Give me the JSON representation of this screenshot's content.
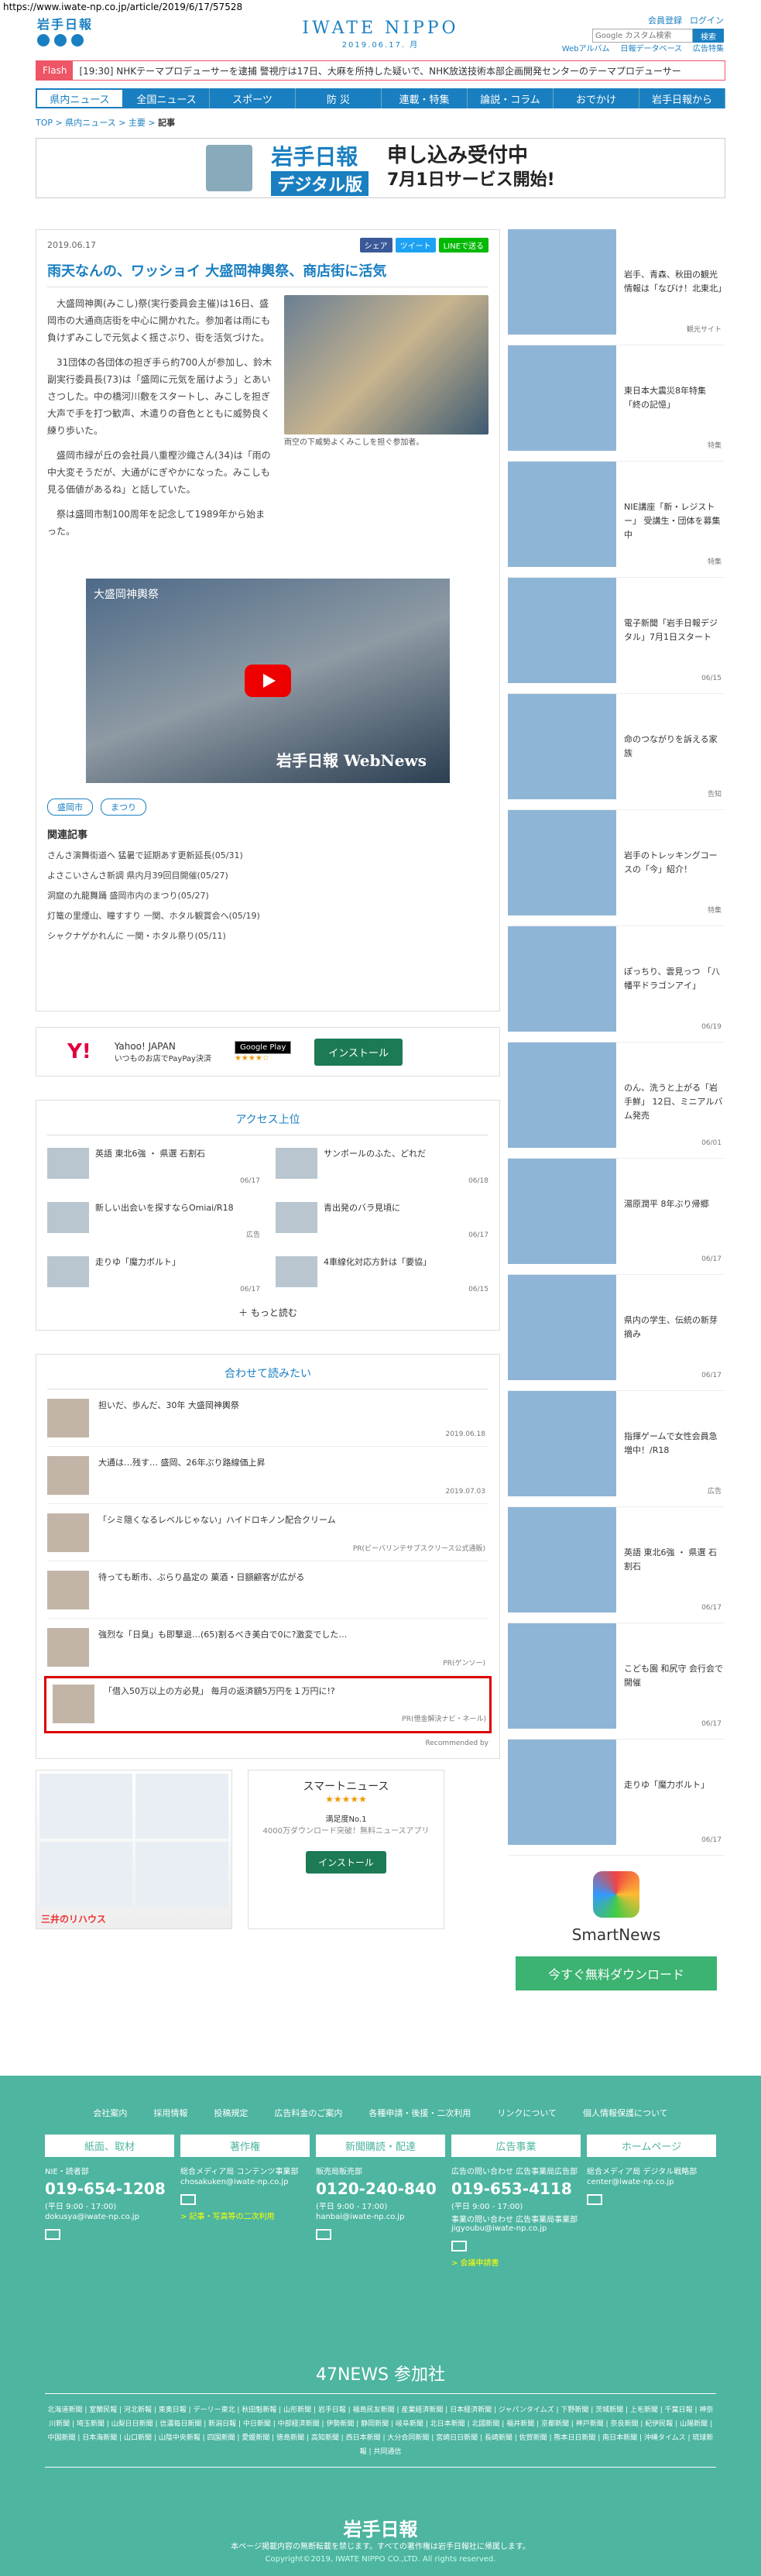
{
  "url": "https://www.iwate-np.co.jp/article/2019/6/17/57528",
  "header": {
    "logo_jp": "岩手日報",
    "logo_en": "IWATE NIPPO",
    "date": "2019.06.17. 月",
    "register": "会員登録",
    "login": "ログイン",
    "search_placeholder": "Google カスタム検索",
    "search_button": "検索"
  },
  "subnav": [
    "Webアルバム",
    "日報データベース",
    "広告特集"
  ],
  "flash": {
    "label": "Flash",
    "text": "[19:30] NHKテーマプロデューサーを逮捕 警視庁は17日、大麻を所持した疑いで、NHK放送技術本部企画開発センターのテーマプロデューサー"
  },
  "nav": [
    "県内ニュース",
    "全国ニュース",
    "スポーツ",
    "防 災",
    "連載・特集",
    "論説・コラム",
    "おでかけ",
    "岩手日報から"
  ],
  "breadcrumb": {
    "top": "TOP",
    "sep": ">",
    "cat": "県内ニュース",
    "sub": "主要",
    "cur": "記事"
  },
  "banner": {
    "logo": "岩手日報",
    "digital": "デジタル版",
    "line1": "申し込み受付中",
    "line2": "7月1日サービス開始!"
  },
  "article": {
    "date": "2019.06.17",
    "share": [
      "シェア",
      "ツイート",
      "LINEで送る"
    ],
    "title": "雨天なんの、ワッショイ 大盛岡神輿祭、商店街に活気",
    "paragraphs": [
      "大盛岡神輿(みこし)祭(実行委員会主催)は16日、盛岡市の大通商店街を中心に開かれた。参加者は雨にも負けずみこしで元気よく揺さぶり、街を活気づけた。",
      "31団体の各団体の担ぎ手ら約700人が参加し、鈴木副実行委員長(73)は「盛岡に元気を届けよう」とあいさつした。中の橋河川敷をスタートし、みこしを担ぎ大声で手を打つ歓声、木遣りの音色とともに威勢良く練り歩いた。",
      "盛岡市緑が丘の会社員八重樫沙織さん(34)は「雨の中大変そうだが、大通がにぎやかになった。みこしも見る価値があるね」と話していた。",
      "祭は盛岡市制100周年を記念して1989年から始まった。"
    ],
    "photo_caption": "雨空の下威勢よくみこしを担ぐ参加者。",
    "video_title": "大盛岡神輿祭",
    "video_wm": "岩手日報 WebNews",
    "tags": [
      "盛岡市",
      "まつり"
    ],
    "related_title": "関連記事",
    "related": [
      "さんさ演舞街道へ 猛暑で延期あす更新延長(05/31)",
      "よさこいさんさ新調 県内月39回目開催(05/27)",
      "洞窟の九龍舞踊 盛岡市内のまつり(05/27)",
      "灯篭の里煙山、瞳すすり 一関、ホタル観賞会へ(05/19)",
      "シャクナゲかれんに 一関・ホタル祭り(05/11)"
    ]
  },
  "ad_strip": {
    "brand": "Y!",
    "title": "Yahoo! JAPAN",
    "desc": "いつものお店でPayPay決済",
    "store": "Google Play",
    "stars": "★★★★☆",
    "install": "インストール"
  },
  "access": {
    "title": "アクセス上位",
    "items": [
      {
        "t": "英語 東北6強 ・ 県選 石割石",
        "d": "06/17"
      },
      {
        "t": "サンボールのふた、どれだ",
        "d": "06/18"
      },
      {
        "t": "新しい出会いを探すならOmiai/R18",
        "d": "広告"
      },
      {
        "t": "青出発のバラ見頃に",
        "d": "06/17"
      },
      {
        "t": "走りゆ「魔力ボルト」",
        "d": "06/17"
      },
      {
        "t": "4車線化対応方針は「要協」",
        "d": "06/15"
      }
    ],
    "more": "＋ もっと読む"
  },
  "read": {
    "title": "合わせて読みたい",
    "items": [
      {
        "t": "担いだ、歩んだ、30年 大盛岡神輿祭",
        "d": "2019.06.18"
      },
      {
        "t": "大通は…残す… 盛岡、26年ぶり路線価上昇",
        "d": "2019.07.03"
      },
      {
        "t": "「シミ隠くなるレベルじゃない」ハイドロキノン配合クリーム",
        "d": "PR(ビーバリンテサブスクリース公式通販)"
      },
      {
        "t": "待っても断市、ぶらり晶定の 菓酒・日額顧客が広がる",
        "d": ""
      },
      {
        "t": "強烈な「日臭」も即撃退…(65)割るべき美白で0に?激変でした…",
        "d": "PR(ゲンソー)"
      },
      {
        "t": "「借入50万以上の方必見」 毎月の返済額5万円を１万円に!?",
        "d": "PR(借金解決ナビ・ネール)"
      }
    ],
    "recommend": "Recommended by"
  },
  "bottom_ad": {
    "brand": "三井のリハウス",
    "title": "スマートニュース",
    "stars": "★★★★★",
    "desc": "満足度No.1",
    "sub": "4000万ダウンロード突破！無料ニュースアプリ",
    "install": "インストール"
  },
  "side": [
    {
      "t": "岩手、青森、秋田の観光情報は「なびけ！北東北」",
      "d": "観光サイト"
    },
    {
      "t": "東日本大震災8年特集 「終の記憶」",
      "d": "特集"
    },
    {
      "t": "NIE講座「新・レジストー」 受講生・団体を募集中",
      "d": "特集"
    },
    {
      "t": "電子新聞「岩手日報デジタル」7月1日スタート",
      "d": "06/15"
    },
    {
      "t": "命のつながりを訴える家族",
      "d": "告知"
    },
    {
      "t": "岩手のトレッキングコースの「今」紹介！",
      "d": "特集"
    },
    {
      "t": "ぽっちり、雲見っつ 「八幡平ドラゴンアイ」",
      "d": "06/19"
    },
    {
      "t": "のん、洗うと上がる「岩手鮮」 12日、ミニアルバム発売",
      "d": "06/01"
    },
    {
      "t": "湯原潤平 8年ぶり帰郷",
      "d": "06/17"
    },
    {
      "t": "県内の学生、伝統の新芽摘み",
      "d": "06/17"
    },
    {
      "t": "指揮ゲームで女性会員急増中！/R18",
      "d": "広告"
    },
    {
      "t": "英語 東北6強 ・ 県選 石割石",
      "d": "06/17"
    },
    {
      "t": "こども園 和尻守 会行会で開催",
      "d": "06/17"
    },
    {
      "t": "走りゆ「魔力ボルト」",
      "d": "06/17"
    }
  ],
  "smartnews": {
    "name": "SmartNews",
    "cta": "今すぐ無料ダウンロード"
  },
  "footer": {
    "links": [
      "会社案内",
      "採用情報",
      "投稿規定",
      "広告料金のご案内",
      "各種申請・後援・二次利用",
      "リンクについて",
      "個人情報保護について"
    ],
    "cols": [
      {
        "h": "紙面、取材",
        "s": "NIE・読者部",
        "tel": "019-654-1208",
        "m": "(平日 9:00 - 17:00)",
        "mail": "dokusya@iwate-np.co.jp",
        "y": ""
      },
      {
        "h": "著作権",
        "s": "総合メディア局 コンテンツ事業部",
        "tel": "",
        "m": "chosakuken@iwate-np.co.jp",
        "mail": "",
        "y": "> 記事・写真等の二次利用"
      },
      {
        "h": "新聞購読・配達",
        "s": "販売局販売部",
        "tel": "0120-240-840",
        "m": "(平日 9:00 - 17:00)",
        "mail": "hanbai@iwate-np.co.jp",
        "y": ""
      },
      {
        "h": "広告事業",
        "s": "広告の問い合わせ 広告事業局広告部",
        "tel": "019-653-4118",
        "m": "(平日 9:00 - 17:00)",
        "mail": "事業の問い合わせ 広告事業局事業部 jigyoubu@iwate-np.co.jp",
        "y": "> 会議申請書"
      },
      {
        "h": "ホームページ",
        "s": "総合メディア局 デジタル戦略部",
        "tel": "",
        "m": "center@iwate-np.co.jp",
        "mail": "",
        "y": ""
      }
    ],
    "n47": "47NEWS 参加社",
    "papers": "北海道新聞 | 室蘭民報 | 河北新報 | 東奥日報 | デーリー東北 | 秋田魁新報 | 山形新聞 | 岩手日報 | 福島民友新聞 | 産業経済新聞 | 日本経済新聞 | ジャパンタイムズ | 下野新聞 | 茨城新聞 | 上毛新聞 | 千葉日報 | 神奈川新聞 | 埼玉新聞 | 山梨日日新聞 | 信濃毎日新聞 | 新潟日報 | 中日新聞 | 中部経済新聞 | 伊勢新聞 | 静岡新聞 | 岐阜新聞 | 北日本新聞 | 北國新聞 | 福井新聞 | 京都新聞 | 神戸新聞 | 奈良新聞 | 紀伊民報 | 山陽新聞 | 中国新聞 | 日本海新聞 | 山口新聞 | 山陰中央新報 | 四国新聞 | 愛媛新聞 | 徳島新聞 | 高知新聞 | 西日本新聞 | 大分合同新聞 | 宮崎日日新聞 | 長崎新聞 | 佐賀新聞 | 熊本日日新聞 | 南日本新聞 | 沖縄タイムス | 琉球新報 | 共同通信",
    "logo": "岩手日報",
    "notice": "本ページ掲載内容の無断転載を禁じます。すべての著作権は岩手日報社に帰属します。",
    "copy": "Copyright©2019, IWATE NIPPO CO.,LTD. All rights reserved."
  }
}
